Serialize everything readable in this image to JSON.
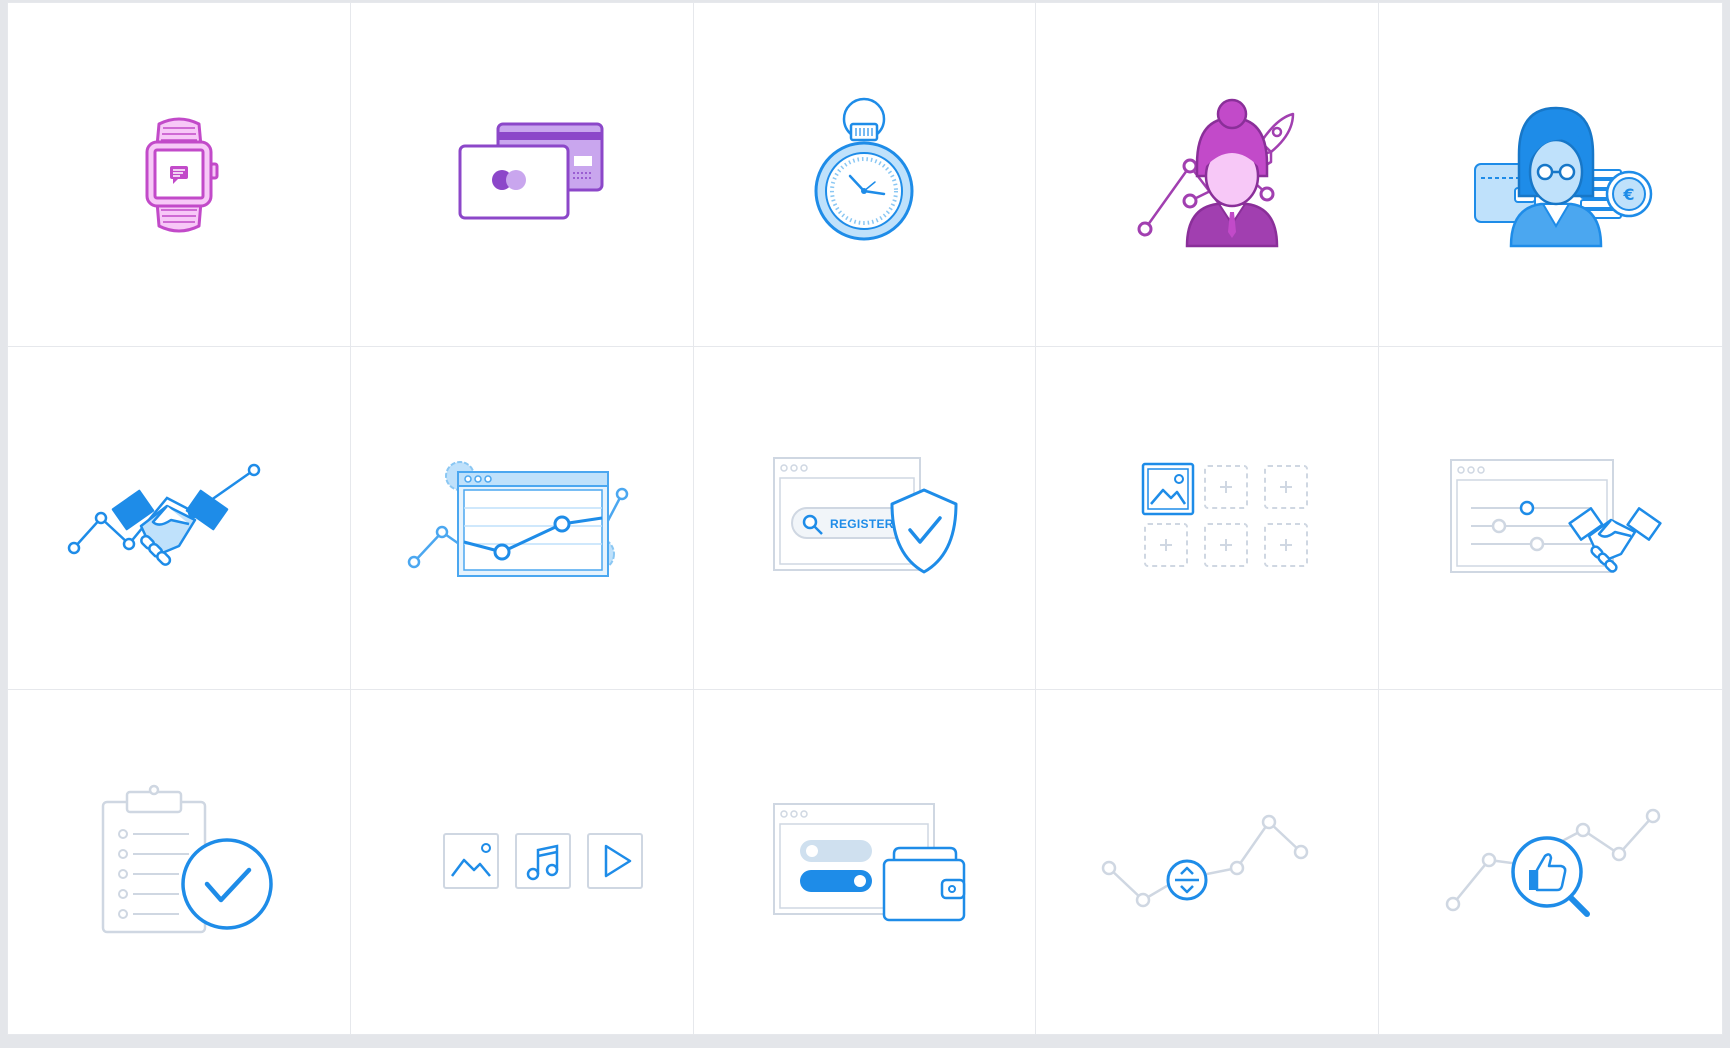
{
  "colors": {
    "magenta": "#c24ac9",
    "magenta_light": "#f7c8f7",
    "purple": "#8c47c9",
    "purple_light": "#c9a6ee",
    "blue": "#1e8ce8",
    "blue_light": "#bfe1fb",
    "pale": "#cfd7e2",
    "white": "#ffffff"
  },
  "icons": [
    {
      "name": "smartwatch-icon"
    },
    {
      "name": "credit-cards-icon"
    },
    {
      "name": "stopwatch-icon"
    },
    {
      "name": "businesswoman-growth-rocket-icon"
    },
    {
      "name": "businesswoman-wallet-euro-icon"
    },
    {
      "name": "handshake-chart-icon"
    },
    {
      "name": "browser-chart-gears-icon"
    },
    {
      "name": "secure-registration-shield-icon"
    },
    {
      "name": "image-upload-slots-icon"
    },
    {
      "name": "browser-sliders-handshake-icon"
    },
    {
      "name": "clipboard-check-icon"
    },
    {
      "name": "media-image-music-video-icon"
    },
    {
      "name": "browser-toggles-wallet-icon"
    },
    {
      "name": "chart-scroll-control-icon"
    },
    {
      "name": "chart-magnifier-thumbs-up-icon"
    }
  ],
  "register_label": "REGISTER",
  "euro_symbol": "€"
}
